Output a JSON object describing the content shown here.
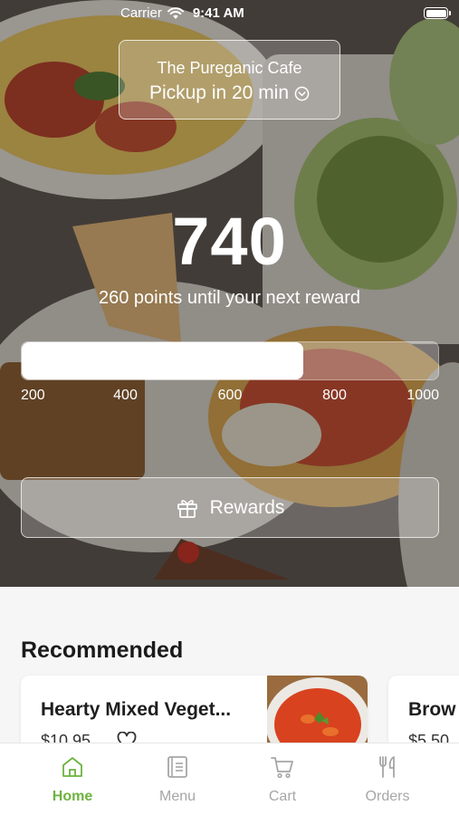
{
  "status_bar": {
    "carrier": "Carrier",
    "time": "9:41 AM"
  },
  "location": {
    "name": "The Pureganic Cafe",
    "pickup": "Pickup in 20 min"
  },
  "points": {
    "value": "740",
    "caption": "260 points until your next reward",
    "progress": {
      "min": 200,
      "max": 1000,
      "current": 740
    },
    "ticks": [
      "200",
      "400",
      "600",
      "800",
      "1000"
    ]
  },
  "rewards_button": {
    "label": "Rewards"
  },
  "recommended": {
    "title": "Recommended",
    "items": [
      {
        "name": "Hearty Mixed Veget...",
        "price": "$10.95"
      },
      {
        "name": "Brow",
        "price": "$5.50"
      }
    ]
  },
  "tabs": [
    {
      "label": "Home",
      "icon": "home-icon",
      "active": true
    },
    {
      "label": "Menu",
      "icon": "menu-book-icon",
      "active": false
    },
    {
      "label": "Cart",
      "icon": "cart-icon",
      "active": false
    },
    {
      "label": "Orders",
      "icon": "fork-knife-icon",
      "active": false
    }
  ],
  "colors": {
    "accent": "#6db33f",
    "inactive": "#a6a6a6"
  }
}
